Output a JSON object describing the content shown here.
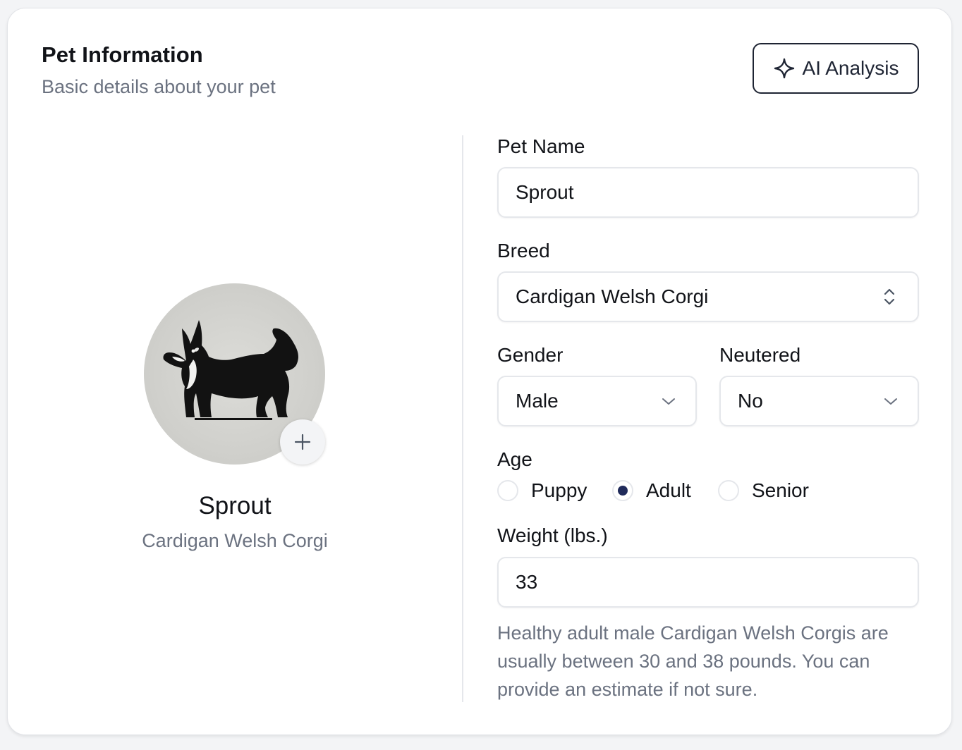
{
  "card": {
    "title": "Pet Information",
    "subtitle": "Basic details about your pet",
    "ai_button_label": "AI Analysis"
  },
  "profile": {
    "name": "Sprout",
    "breed": "Cardigan Welsh Corgi",
    "avatar_icon": "corgi-silhouette-photo",
    "add_photo_icon": "plus-icon"
  },
  "form": {
    "pet_name": {
      "label": "Pet Name",
      "value": "Sprout"
    },
    "breed": {
      "label": "Breed",
      "value": "Cardigan Welsh Corgi"
    },
    "gender": {
      "label": "Gender",
      "value": "Male"
    },
    "neutered": {
      "label": "Neutered",
      "value": "No"
    },
    "age": {
      "label": "Age",
      "options": [
        "Puppy",
        "Adult",
        "Senior"
      ],
      "selected": "Adult"
    },
    "weight": {
      "label": "Weight (lbs.)",
      "value": "33"
    },
    "weight_helper": "Healthy adult male Cardigan Welsh Corgis are usually between 30 and 38 pounds. You can provide an estimate if not sure."
  },
  "colors": {
    "accent": "#1f2a5a",
    "text": "#111318",
    "muted": "#6b7280",
    "border": "#e5e7eb"
  }
}
